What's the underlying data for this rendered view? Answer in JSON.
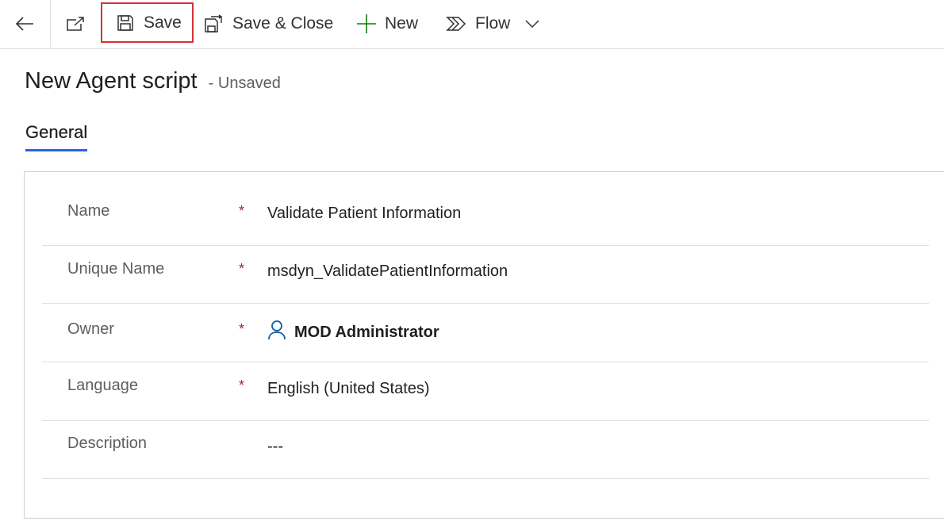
{
  "toolbar": {
    "save_label": "Save",
    "save_close_label": "Save & Close",
    "new_label": "New",
    "flow_label": "Flow"
  },
  "header": {
    "title": "New Agent script",
    "status": "- Unsaved"
  },
  "tabs": [
    {
      "label": "General",
      "active": true
    }
  ],
  "form": {
    "fields": [
      {
        "label": "Name",
        "required": "*",
        "value": "Validate Patient Information"
      },
      {
        "label": "Unique Name",
        "required": "*",
        "value": "msdyn_ValidatePatientInformation"
      },
      {
        "label": "Owner",
        "required": "*",
        "value": "MOD Administrator"
      },
      {
        "label": "Language",
        "required": "*",
        "value": "English (United States)"
      },
      {
        "label": "Description",
        "required": "",
        "value": "---"
      }
    ]
  },
  "colors": {
    "accent": "#2266e3",
    "required": "#a4262c",
    "link": "#115ea3",
    "highlight_border": "#d13438",
    "new_plus": "#107c10"
  },
  "icons": {
    "back": "back-arrow-icon",
    "popout": "popout-icon",
    "save": "save-icon",
    "save_close": "save-close-icon",
    "new": "plus-icon",
    "flow": "flow-icon",
    "chevron": "chevron-down-icon",
    "owner": "person-icon"
  }
}
